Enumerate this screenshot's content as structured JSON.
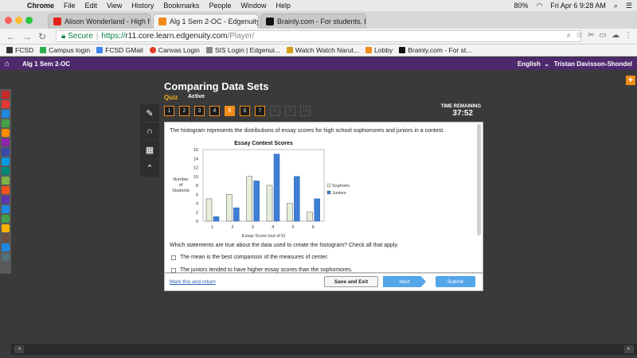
{
  "menubar": {
    "app": "Chrome",
    "items": [
      "File",
      "Edit",
      "View",
      "History",
      "Bookmarks",
      "People",
      "Window",
      "Help"
    ],
    "battery": "80%",
    "datetime": "Fri Apr 6  9:28 AM"
  },
  "tabs": [
    {
      "label": "Alison Wonderland - High f",
      "icon_color": "#e62117"
    },
    {
      "label": "Alg 1 Sem 2-OC - Edgenuity.co",
      "icon_color": "#f28c1a"
    },
    {
      "label": "Brainly.com - For students. By",
      "icon_color": "#111111"
    }
  ],
  "address": {
    "secure": "Secure",
    "scheme": "https://",
    "host": "r11.core.learn.edgenuity.com",
    "path": "/Player/"
  },
  "bookmarks": [
    {
      "label": "FCSD",
      "color": "#333333"
    },
    {
      "label": "Campus login",
      "color": "#2bb24c"
    },
    {
      "label": "FCSD GMail",
      "color": "#4285f4"
    },
    {
      "label": "Canvas Login",
      "color": "#e13f2b"
    },
    {
      "label": "SIS Login | Edgenui...",
      "color": "#888888"
    },
    {
      "label": "Watch Watch Narut...",
      "color": "#d4a017"
    },
    {
      "label": "Lobby",
      "color": "#f28c1a"
    },
    {
      "label": "Brainly.com - For st...",
      "color": "#111111"
    }
  ],
  "appbar": {
    "course": "Alg 1 Sem 2-OC",
    "language": "English",
    "user": "Tristan Davisson-Shondel"
  },
  "page": {
    "title": "Comparing Data Sets",
    "mode": "Quiz",
    "status": "Active",
    "question_numbers": [
      "1",
      "2",
      "3",
      "4",
      "5",
      "6",
      "7",
      "8",
      "9",
      "10"
    ],
    "current_question": 5,
    "unlocked_through": 7,
    "timer_label": "TIME REMAINING",
    "timer": "37:52"
  },
  "question": {
    "prompt": "The histogram represents the distributions of essay scores for high school sophomores and juniors in a contest.",
    "instruction": "Which statements are true about the data used to create the histogram? Check all that apply.",
    "options": [
      "The mean is the best comparison of the measures of center.",
      "The juniors tended to have higher essay scores than the sophomores."
    ]
  },
  "footer": {
    "mark_link": "Mark this and return",
    "save": "Save and Exit",
    "next": "Next",
    "submit": "Submit"
  },
  "chart_data": {
    "type": "bar",
    "title": "Essay Contest Scores",
    "xlabel": "Essay Score (out of 6)",
    "ylabel": "Number of Students",
    "categories": [
      "1",
      "2",
      "3",
      "4",
      "5",
      "6"
    ],
    "ylim": [
      0,
      16
    ],
    "yticks": [
      "0",
      "2",
      "4",
      "6",
      "8",
      "10",
      "12",
      "14",
      "16"
    ],
    "series": [
      {
        "name": "Sophomores",
        "values": [
          5,
          6,
          10,
          8,
          4,
          2
        ],
        "color": "#e6efd9"
      },
      {
        "name": "Juniors",
        "values": [
          1,
          3,
          9,
          15,
          10,
          5
        ],
        "color": "#3d7fd6"
      }
    ]
  }
}
